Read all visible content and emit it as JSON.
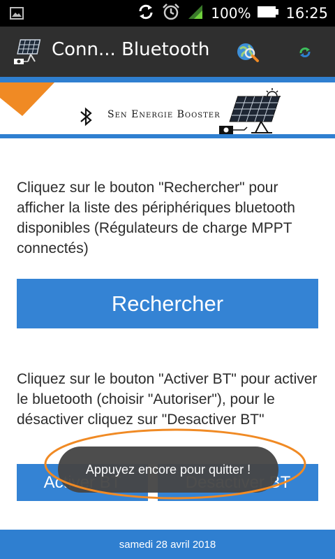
{
  "status_bar": {
    "battery_percent": "100%",
    "time": "16:25",
    "icons": [
      "image-icon",
      "sync-icon",
      "alarm-icon",
      "signal-icon",
      "battery-icon"
    ]
  },
  "action_bar": {
    "title": "Conn... Bluetooth",
    "icons": [
      "solar-panel-app-icon",
      "search-globe-icon",
      "refresh-icon"
    ]
  },
  "banner": {
    "text": "Sen Energie Booster",
    "colors": {
      "band": "#2f7fd0",
      "accent": "#f08a24"
    }
  },
  "main": {
    "search_instructions": "Cliquez sur le bouton \"Rechercher\" pour afficher la liste des périphériques bluetooth disponibles (Régulateurs de charge MPPT connectés)",
    "search_button": "Rechercher",
    "bt_instructions": "Cliquez sur le bouton \"Activer BT\" pour activer le bluetooth (choisir \"Autoriser\"), pour le désactiver cliquez sur \"Desactiver BT\"",
    "enable_bt_button": "Activer BT",
    "disable_bt_button": "Desactiver BT",
    "button_color": "#3483d4"
  },
  "toast": {
    "message": "Appuyez encore pour quitter !",
    "highlight_color": "#f08a24"
  },
  "footer": {
    "date": "samedi 28 avril 2018"
  }
}
